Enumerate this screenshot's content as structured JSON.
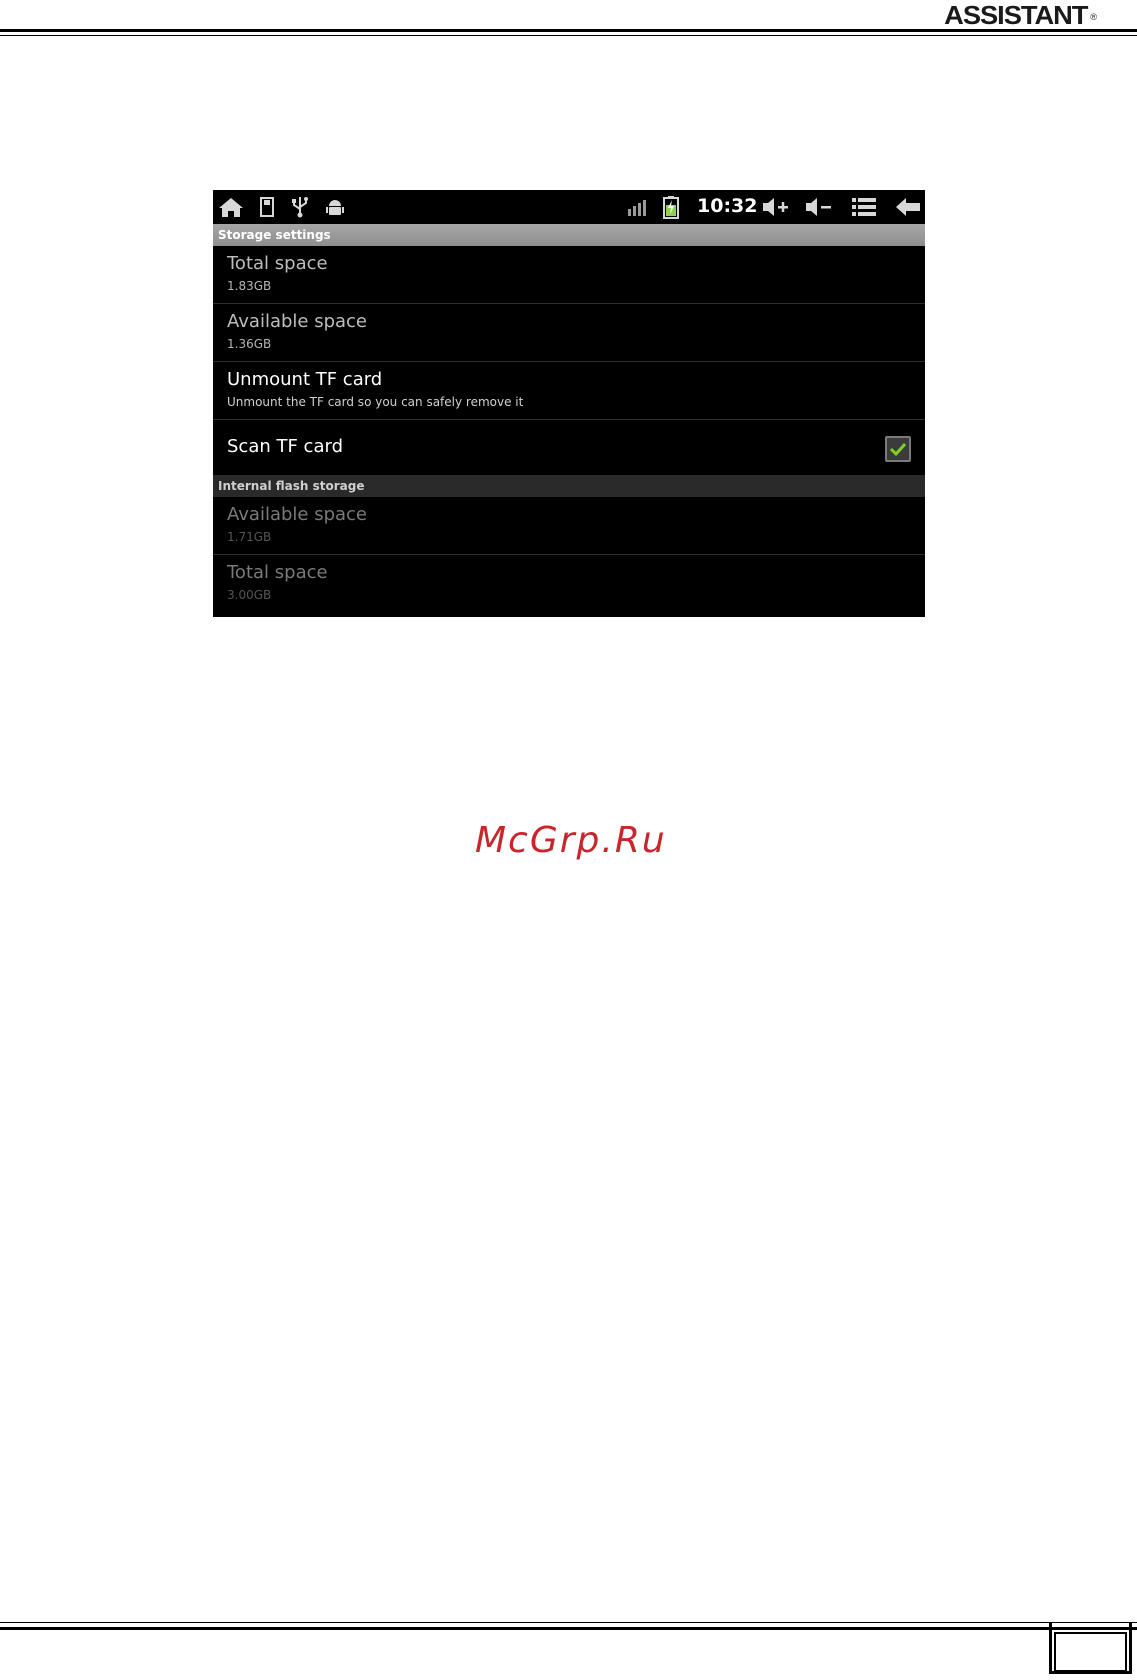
{
  "brand": {
    "name": "ASSISTANT",
    "reg_mark": "®"
  },
  "watermark": {
    "text": "McGrp.Ru"
  },
  "statusbar": {
    "time": "10:32",
    "icons_left": [
      "home-icon",
      "sd-card-icon",
      "usb-icon",
      "android-debug-icon"
    ],
    "icons_right": [
      "signal-icon",
      "battery-charging-icon",
      "volume-up-icon",
      "volume-down-icon",
      "menu-icon",
      "back-icon"
    ]
  },
  "storage_settings": {
    "header": "Storage settings",
    "items": [
      {
        "title": "Total space",
        "subtitle": "1.83GB"
      },
      {
        "title": "Available space",
        "subtitle": "1.36GB"
      },
      {
        "title": "Unmount TF card",
        "subtitle": "Unmount the TF card so you can safely remove it"
      },
      {
        "title": "Scan TF card",
        "checked": true
      }
    ]
  },
  "internal_storage": {
    "header": "Internal flash storage",
    "items": [
      {
        "title": "Available space",
        "subtitle": "1.71GB"
      },
      {
        "title": "Total space",
        "subtitle": "3.00GB"
      }
    ]
  },
  "colors": {
    "checkmark": "#7ed321",
    "battery": "#8bd34a"
  }
}
